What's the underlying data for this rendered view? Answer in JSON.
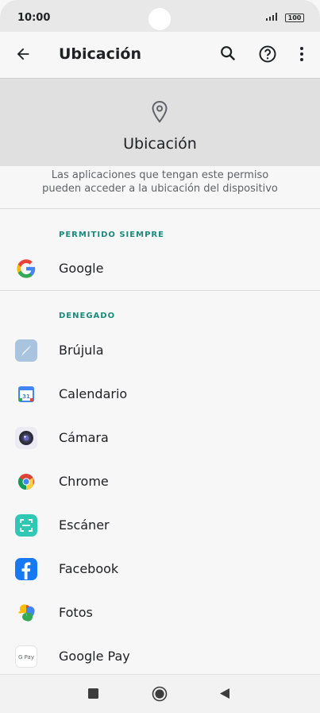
{
  "status": {
    "time": "10:00",
    "battery": "100"
  },
  "appbar": {
    "title": "Ubicación"
  },
  "hero": {
    "title": "Ubicación"
  },
  "description": {
    "line1": "Las aplicaciones que tengan este permiso",
    "line2": "pueden acceder a la ubicación del dispositivo"
  },
  "sections": {
    "allowed": {
      "title": "PERMITIDO SIEMPRE",
      "items": [
        {
          "label": "Google",
          "icon": "google-icon"
        }
      ]
    },
    "denied": {
      "title": "DENEGADO",
      "items": [
        {
          "label": "Brújula",
          "icon": "compass-icon"
        },
        {
          "label": "Calendario",
          "icon": "calendar-icon"
        },
        {
          "label": "Cámara",
          "icon": "camera-icon"
        },
        {
          "label": "Chrome",
          "icon": "chrome-icon"
        },
        {
          "label": "Escáner",
          "icon": "scanner-icon"
        },
        {
          "label": "Facebook",
          "icon": "facebook-icon"
        },
        {
          "label": "Fotos",
          "icon": "photos-icon"
        },
        {
          "label": "Google Pay",
          "icon": "google-pay-icon"
        }
      ]
    }
  },
  "calendar_day": "31",
  "gpay_text": "G Pay",
  "colors": {
    "accent": "#1a8a7a",
    "facebook": "#1877f2"
  }
}
